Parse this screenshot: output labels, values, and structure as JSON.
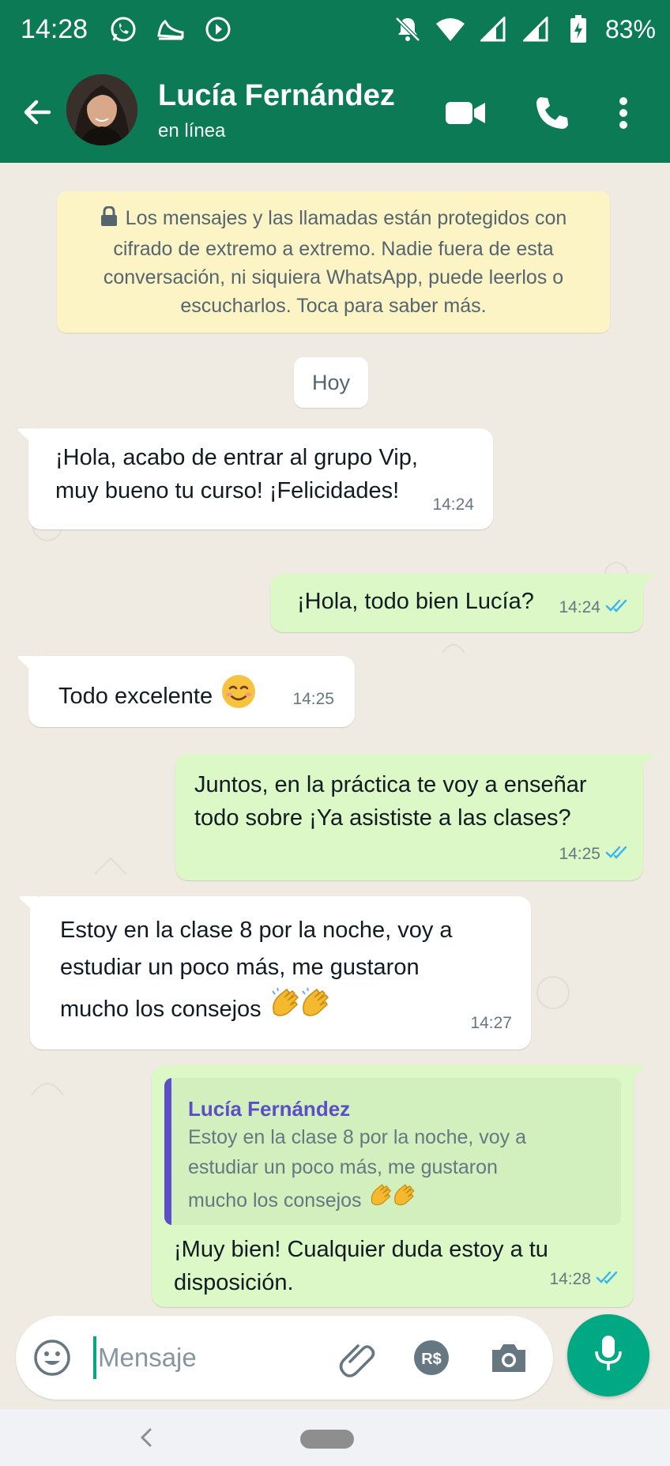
{
  "status_bar": {
    "time": "14:28",
    "battery": "83%",
    "left_icons": [
      "whatsapp-icon",
      "shoe-icon",
      "cast-icon"
    ],
    "right_icons": [
      "bell-off-icon",
      "wifi-icon",
      "signal-icon",
      "signal-icon",
      "battery-icon"
    ]
  },
  "header": {
    "contact_name": "Lucía Fernández",
    "status": "en línea",
    "icons": [
      "back-arrow-icon",
      "video-call-icon",
      "phone-call-icon",
      "more-vert-icon"
    ]
  },
  "chat": {
    "encryption_notice": "Los mensajes y las llamadas están protegidos con cifrado de extremo a extremo. Nadie fuera de esta conversación, ni siquiera WhatsApp, puede leerlos o escucharlos. Toca para saber más.",
    "date_chip": "Hoy",
    "messages": [
      {
        "direction": "in",
        "lines": [
          "¡Hola, acabo de entrar al grupo Vip,",
          "muy bueno tu curso! ¡Felicidades!"
        ],
        "time": "14:24"
      },
      {
        "direction": "out",
        "lines": [
          "¡Hola, todo bien Lucía?"
        ],
        "time": "14:24",
        "read": true
      },
      {
        "direction": "in",
        "lines": [
          "Todo excelente"
        ],
        "emoji": "smiling-face",
        "time": "14:25"
      },
      {
        "direction": "out",
        "lines": [
          "Juntos, en la práctica te voy a enseñar",
          "todo sobre ¡Ya asististe a las clases?"
        ],
        "time": "14:25",
        "read": true
      },
      {
        "direction": "in",
        "lines": [
          "Estoy en la clase 8 por la noche, voy a",
          "estudiar un poco más, me gustaron",
          "mucho los consejos"
        ],
        "emoji": "clapping-hands x2",
        "time": "14:27"
      },
      {
        "direction": "out",
        "quote_author": "Lucía Fernández",
        "quote_lines": [
          "Estoy en la clase 8 por la noche, voy a",
          "estudiar un poco más, me gustaron",
          "mucho los consejos"
        ],
        "lines": [
          "¡Muy bien! Cualquier duda estoy a tu",
          "disposición."
        ],
        "time": "14:28",
        "read": true
      }
    ]
  },
  "composer": {
    "placeholder": "Mensaje",
    "icons": [
      "emoji-icon",
      "attach-icon",
      "payment-icon",
      "camera-icon",
      "mic-icon"
    ],
    "payment_label": "R$"
  },
  "colors": {
    "header": "#0b7a55",
    "outgoing_bubble": "#dcf8c6",
    "incoming_bubble": "#ffffff",
    "read_ticks": "#34b7f1",
    "accent": "#00a884",
    "notice_bg": "#fdf4c5"
  }
}
